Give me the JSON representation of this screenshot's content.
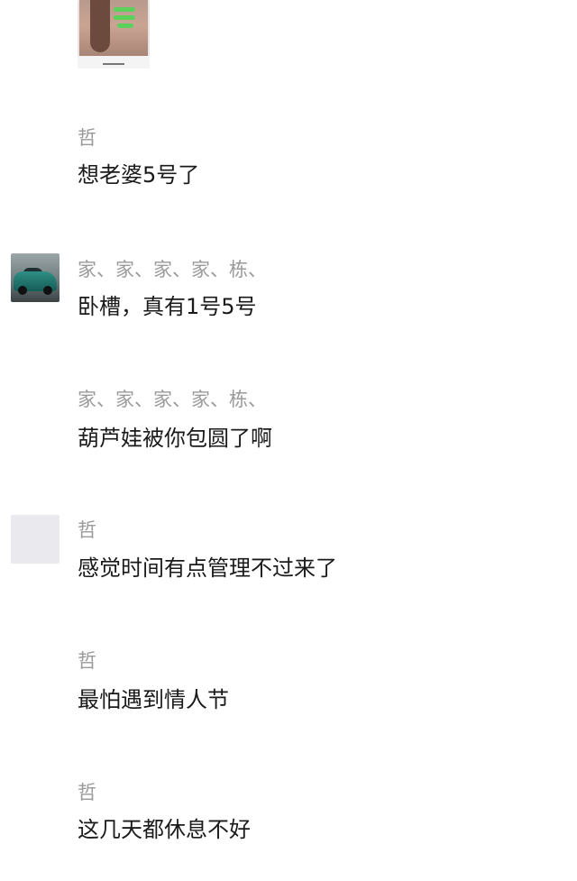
{
  "messages": [
    {
      "name": "哲",
      "text": "想老婆5号了"
    },
    {
      "name": "家、家、家、家、栋、",
      "text": "卧槽，真有1号5号"
    },
    {
      "name": "家、家、家、家、栋、",
      "text": "葫芦娃被你包圆了啊"
    },
    {
      "name": "哲",
      "text": "感觉时间有点管理不过来了"
    },
    {
      "name": "哲",
      "text": "最怕遇到情人节"
    },
    {
      "name": "哲",
      "text": "这几天都休息不好"
    }
  ]
}
